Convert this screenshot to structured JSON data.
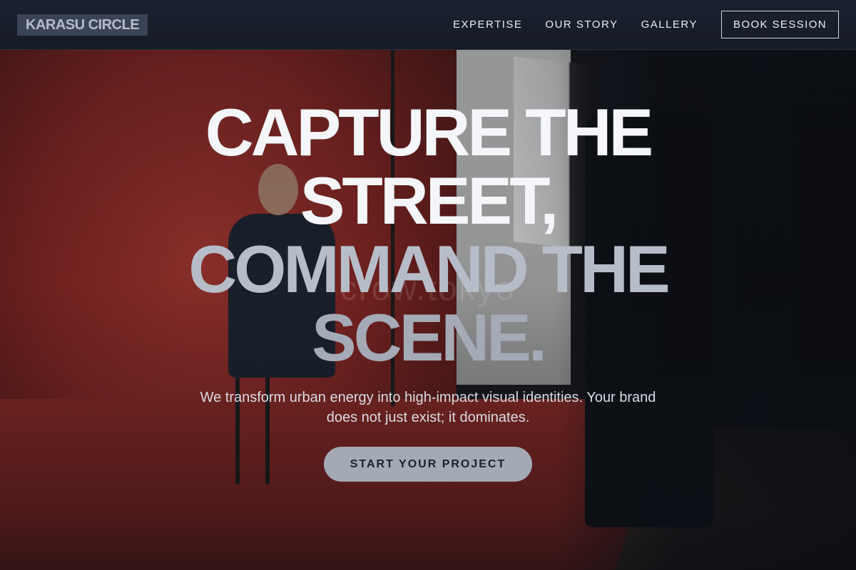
{
  "header": {
    "logo": "KARASU CIRCLE",
    "nav": [
      "EXPERTISE",
      "OUR STORY",
      "GALLERY"
    ],
    "cta_label": "BOOK SESSION"
  },
  "hero": {
    "headline_lines": [
      "CAPTURE THE",
      "STREET,",
      "COMMAND THE",
      "SCENE."
    ],
    "subtitle": "We transform urban energy into high-impact visual identities. Your brand does not just exist; it dominates.",
    "cta_label": "START YOUR PROJECT",
    "watermark": "crow.tokyo"
  },
  "colors": {
    "header_bg": "#161b26",
    "logo_bg": "#3b4356",
    "cta_bg": "#a3aab5",
    "backdrop_red": "#8f2620"
  }
}
